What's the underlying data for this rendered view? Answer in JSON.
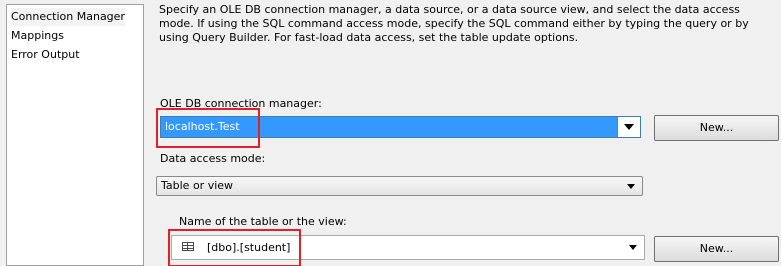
{
  "nav": {
    "items": [
      {
        "label": "Connection Manager"
      },
      {
        "label": "Mappings"
      },
      {
        "label": "Error Output"
      }
    ]
  },
  "main": {
    "description": "Specify an OLE DB connection manager, a data source, or a data source view, and select the data access mode. If using the SQL command access mode, specify the SQL command either by typing the query or by using Query Builder. For fast-load data access, set the table update options.",
    "connection_manager": {
      "label": "OLE DB connection manager:",
      "value": "localhost.Test",
      "new_button": "New...",
      "arrow_icon": "chevron-down-icon"
    },
    "data_access_mode": {
      "label": "Data access mode:",
      "value": "Table or view",
      "arrow_icon": "chevron-down-icon"
    },
    "table": {
      "label": "Name of the table or the view:",
      "value": "[dbo].[student]",
      "icon": "table-icon",
      "new_button": "New...",
      "arrow_icon": "chevron-down-icon"
    }
  },
  "colors": {
    "selection": "#3399ff",
    "highlight_box": "#e0212a"
  }
}
